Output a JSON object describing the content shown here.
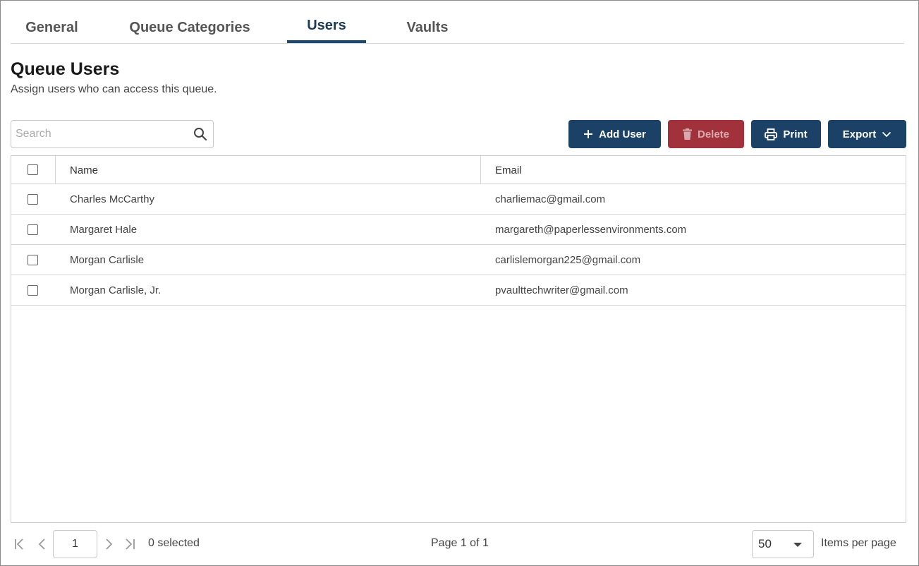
{
  "tabs": [
    {
      "label": "General"
    },
    {
      "label": "Queue Categories"
    },
    {
      "label": "Users",
      "active": true
    },
    {
      "label": "Vaults"
    }
  ],
  "page": {
    "title": "Queue Users",
    "subtitle": "Assign users who can access this queue."
  },
  "search": {
    "placeholder": "Search",
    "value": ""
  },
  "toolbar": {
    "add_label": "Add User",
    "delete_label": "Delete",
    "print_label": "Print",
    "export_label": "Export"
  },
  "table": {
    "columns": [
      "Name",
      "Email"
    ],
    "rows": [
      {
        "name": "Charles McCarthy",
        "email": "charliemac@gmail.com"
      },
      {
        "name": "Margaret Hale",
        "email": "margareth@paperlessenvironments.com"
      },
      {
        "name": "Morgan Carlisle",
        "email": "carlislemorgan225@gmail.com"
      },
      {
        "name": "Morgan Carlisle, Jr.",
        "email": "pvaulttechwriter@gmail.com"
      }
    ]
  },
  "pager": {
    "current_page": "1",
    "selected_text": "0 selected",
    "page_info": "Page 1 of 1",
    "per_page": "50",
    "per_page_label": "Items per page"
  },
  "colors": {
    "primary": "#1b4266",
    "danger": "#a1313a",
    "tab_active": "#1b4a70"
  }
}
